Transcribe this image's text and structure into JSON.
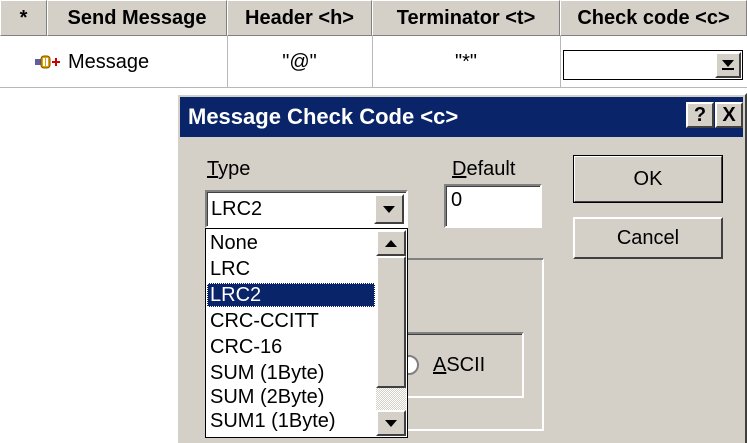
{
  "grid": {
    "columns": [
      "*",
      "Send Message",
      "Header <h>",
      "Terminator <t>",
      "Check code <c>"
    ],
    "row": {
      "name": "Message",
      "header": "\"@\"",
      "terminator": "\"*\"",
      "check_code": ""
    }
  },
  "dialog": {
    "title": "Message Check Code <c>",
    "help_button": "?",
    "close_button": "X",
    "type_label_underlined": "T",
    "type_label_rest": "ype",
    "type_value": "LRC2",
    "default_label_underlined": "D",
    "default_label_rest": "efault",
    "default_value": "0",
    "ok_button": "OK",
    "cancel_button": "Cancel",
    "ascii_label_underlined": "A",
    "ascii_label_rest": "SCII",
    "type_options": [
      "None",
      "LRC",
      "LRC2",
      "CRC-CCITT",
      "CRC-16",
      "SUM (1Byte)",
      "SUM (2Byte)",
      "SUM1 (1Byte)"
    ],
    "selected_option": "LRC2"
  },
  "colors": {
    "titlebar": "#0a246a",
    "face": "#d4d0c8",
    "selection": "#0a246a"
  },
  "icons": {
    "row_icon": "message-connector-icon",
    "cell_dropdown": "dropdown-arrow-icon"
  }
}
